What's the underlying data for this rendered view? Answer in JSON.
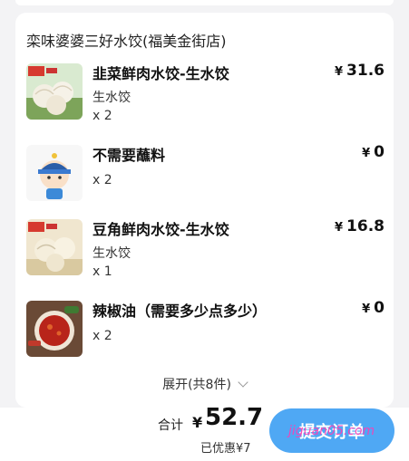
{
  "store": {
    "name": "栾味婆婆三好水饺(福美金街店)"
  },
  "items": [
    {
      "name": "韭菜鲜肉水饺-生水饺",
      "spec": "生水饺",
      "qty": "x 2",
      "currency": "¥",
      "price": "31.6",
      "thumb_icon": "dumpling-bowl-icon"
    },
    {
      "name": "不需要蘸料",
      "spec": "",
      "qty": "x 2",
      "currency": "¥",
      "price": "0",
      "thumb_icon": "cartoon-kid-icon"
    },
    {
      "name": "豆角鲜肉水饺-生水饺",
      "spec": "生水饺",
      "qty": "x 1",
      "currency": "¥",
      "price": "16.8",
      "thumb_icon": "dumpling-plate-icon"
    },
    {
      "name": "辣椒油（需要多少点多少）",
      "spec": "",
      "qty": "x 2",
      "currency": "¥",
      "price": "0",
      "thumb_icon": "chili-oil-icon"
    }
  ],
  "expand": {
    "label": "展开(共8件)"
  },
  "footer": {
    "total_label": "合计",
    "currency": "¥",
    "total_value": "52.7",
    "discount_text": "已优惠¥7",
    "submit_label": "提交订单",
    "watermark": "jiguan05.com"
  },
  "colors": {
    "accent": "#4fa8f4",
    "background": "#f3f3f5",
    "card": "#ffffff",
    "watermark": "#ff3db4"
  }
}
